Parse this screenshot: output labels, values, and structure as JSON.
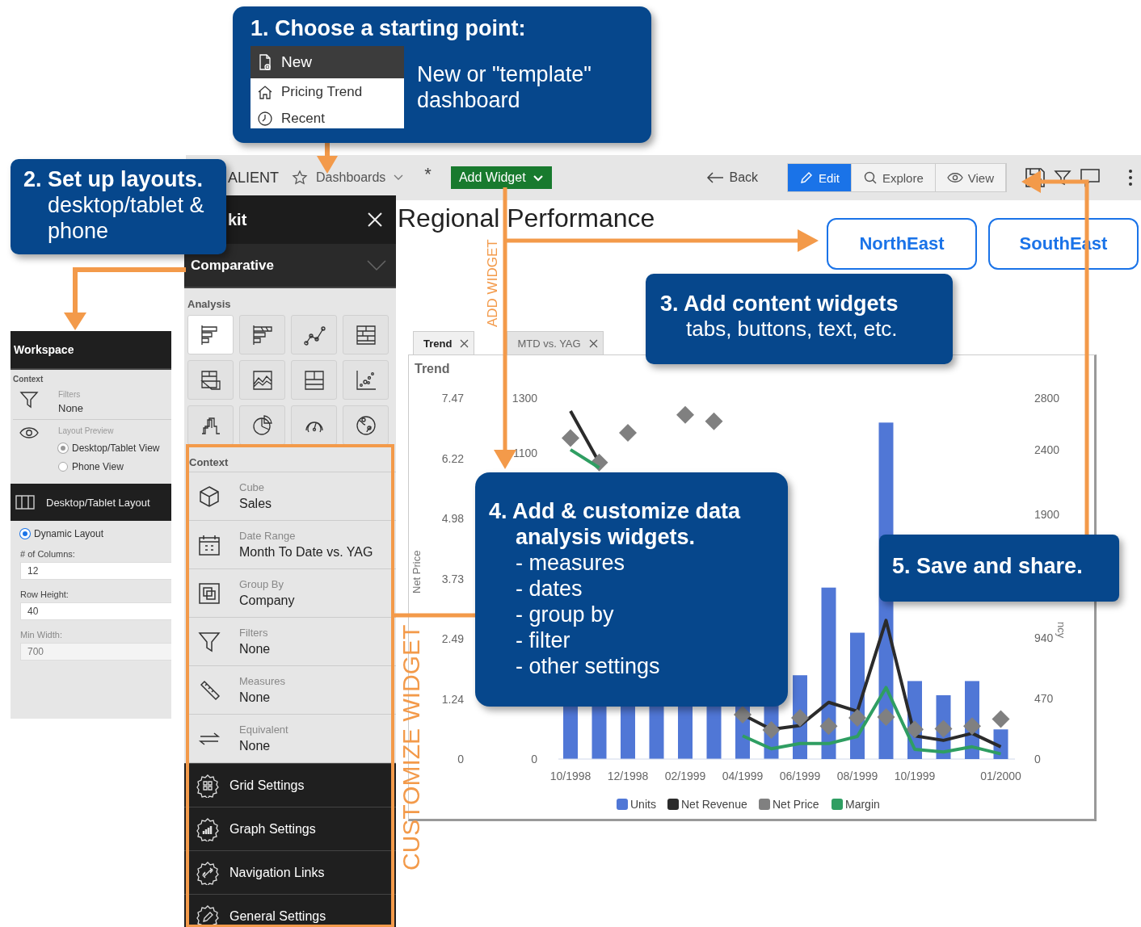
{
  "toolbar": {
    "app_name": "ALIENT",
    "dashboards": "Dashboards",
    "modified_mark": "*",
    "add_widget": "Add Widget",
    "back": "Back",
    "modes": [
      {
        "kind": "edit",
        "label": "Edit",
        "selected": true
      },
      {
        "kind": "explore",
        "label": "Explore",
        "selected": false
      },
      {
        "kind": "view",
        "label": "View",
        "selected": false
      }
    ]
  },
  "page": {
    "title": "Regional Performance",
    "buttons": [
      "NorthEast",
      "SouthEast"
    ]
  },
  "widget": {
    "tabs": [
      {
        "label": "Trend",
        "selected": true
      },
      {
        "label": "MTD vs. YAG",
        "selected": false
      }
    ],
    "title": "Trend",
    "left_axis_title": "Net Price",
    "right_axis_title": "ncy",
    "net_price_ticks": [
      "7.47",
      "6.22",
      "4.98",
      "3.73",
      "2.49",
      "1.24",
      "0"
    ],
    "second_axis_ticks": [
      "1300",
      "1100",
      "0"
    ],
    "chart_data": {
      "type": "bar",
      "categories": [
        "10/1998",
        null,
        "12/1998",
        null,
        "02/1999",
        null,
        "04/1999",
        null,
        "06/1999",
        null,
        "08/1999",
        null,
        "10/1999",
        null,
        null,
        "01/2000"
      ],
      "ylim": [
        0,
        2800
      ],
      "yticks": [
        0,
        470,
        940,
        1900,
        2400,
        2800
      ],
      "legend": "bottom",
      "series": [
        {
          "name": "Units",
          "type": "bar",
          "color": "#5077d6",
          "values": [
            null,
            null,
            null,
            null,
            null,
            null,
            null,
            null,
            650,
            1330,
            980,
            2610,
            605,
            495,
            605,
            230
          ]
        },
        {
          "name": "Net Revenue",
          "type": "line",
          "color": "#2b2b2b",
          "values": [
            2700,
            2300,
            null,
            null,
            null,
            null,
            345,
            230,
            260,
            440,
            370,
            1075,
            180,
            145,
            200,
            95
          ]
        },
        {
          "name": "Net Price",
          "type": "scatter",
          "color": "#808080",
          "values": [
            2490,
            2300,
            2530,
            null,
            2670,
            2620,
            345,
            225,
            320,
            255,
            320,
            325,
            230,
            235,
            255,
            310
          ]
        },
        {
          "name": "Margin",
          "type": "line",
          "color": "#2f9e62",
          "values": [
            2400,
            2260,
            null,
            null,
            null,
            null,
            180,
            80,
            120,
            120,
            175,
            555,
            75,
            55,
            95,
            40
          ]
        }
      ]
    }
  },
  "kit": {
    "title": "kit",
    "category": "Comparative",
    "analysis_heading": "Analysis",
    "tiles": [
      {
        "kind": "bar",
        "selected": true
      },
      {
        "kind": "stacked",
        "selected": false
      },
      {
        "kind": "line",
        "selected": false
      },
      {
        "kind": "grid",
        "selected": false
      },
      {
        "kind": "pivot",
        "selected": false
      },
      {
        "kind": "area",
        "selected": false
      },
      {
        "kind": "layout",
        "selected": false
      },
      {
        "kind": "scatter",
        "selected": false
      },
      {
        "kind": "step",
        "selected": false
      },
      {
        "kind": "pie",
        "selected": false
      },
      {
        "kind": "gauge",
        "selected": false
      },
      {
        "kind": "map",
        "selected": false
      }
    ],
    "context_heading": "Context",
    "context": [
      {
        "kind": "cube",
        "label": "Cube",
        "value": "Sales"
      },
      {
        "kind": "calendar",
        "label": "Date Range",
        "value": "Month To Date vs. YAG"
      },
      {
        "kind": "group",
        "label": "Group By",
        "value": "Company"
      },
      {
        "kind": "filter",
        "label": "Filters",
        "value": "None"
      },
      {
        "kind": "ruler",
        "label": "Measures",
        "value": "None"
      },
      {
        "kind": "swap",
        "label": "Equivalent",
        "value": "None"
      }
    ],
    "settings": [
      {
        "kind": "grid",
        "label": "Grid Settings"
      },
      {
        "kind": "graph",
        "label": "Graph Settings"
      },
      {
        "kind": "link",
        "label": "Navigation Links"
      },
      {
        "kind": "pencil",
        "label": "General Settings"
      }
    ]
  },
  "workspace": {
    "title": "Workspace",
    "context_heading": "Context",
    "filters_label": "Filters",
    "filters_value": "None",
    "preview_label": "Layout Preview",
    "preview_options": [
      {
        "label": "Desktop/Tablet View",
        "selected": true
      },
      {
        "label": "Phone View",
        "selected": false
      }
    ],
    "layout_title": "Desktop/Tablet Layout",
    "layout_mode": {
      "label": "Dynamic Layout",
      "selected": true
    },
    "fields": [
      {
        "label": "# of Columns:",
        "value": "12",
        "disabled": false
      },
      {
        "label": "Row Height:",
        "value": "40",
        "disabled": false
      },
      {
        "label": "Min Width:",
        "value": "700",
        "disabled": true
      }
    ]
  },
  "callout_start": {
    "title": "1. Choose a starting point:",
    "menu": [
      {
        "kind": "new",
        "label": "New",
        "selected": true
      },
      {
        "kind": "home",
        "label": "Pricing Trend",
        "selected": false
      },
      {
        "kind": "clock",
        "label": "Recent",
        "selected": false
      }
    ],
    "note": "New or \"template\" dashboard"
  },
  "callout_layouts": {
    "title": "2. Set up layouts.",
    "note": "desktop/tablet & phone"
  },
  "callout_content": {
    "title": "3. Add content widgets",
    "note": "tabs, buttons, text, etc."
  },
  "callout_analysis": {
    "title": "4. Add & customize data analysis widgets.",
    "items": [
      "- measures",
      "- dates",
      "- group by",
      "- filter",
      "- other settings"
    ]
  },
  "callout_save": {
    "title": "5. Save and share."
  },
  "labels": {
    "add_widget": "ADD WIDGET",
    "customize_widget": "CUSTOMIZE WIDGET"
  }
}
